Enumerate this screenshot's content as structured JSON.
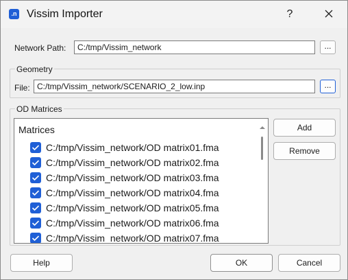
{
  "window": {
    "title": "Vissim Importer",
    "icon_label": ".n",
    "help_glyph": "?"
  },
  "network": {
    "label": "Network Path:",
    "value": "C:/tmp/Vissim_network",
    "browse_label": "..."
  },
  "geometry": {
    "group_title": "Geometry",
    "file_label": "File:",
    "value": "C:/tmp/Vissim_network/SCENARIO_2_low.inp",
    "browse_label": "..."
  },
  "od": {
    "group_title": "OD Matrices",
    "list_header": "Matrices",
    "items": [
      {
        "label": "C:/tmp/Vissim_network/OD matrix01.fma",
        "checked": true
      },
      {
        "label": "C:/tmp/Vissim_network/OD matrix02.fma",
        "checked": true
      },
      {
        "label": "C:/tmp/Vissim_network/OD matrix03.fma",
        "checked": true
      },
      {
        "label": "C:/tmp/Vissim_network/OD matrix04.fma",
        "checked": true
      },
      {
        "label": "C:/tmp/Vissim_network/OD matrix05.fma",
        "checked": true
      },
      {
        "label": "C:/tmp/Vissim_network/OD matrix06.fma",
        "checked": true
      },
      {
        "label": "C:/tmp/Vissim_network/OD matrix07.fma",
        "checked": true
      }
    ],
    "add_label": "Add",
    "remove_label": "Remove"
  },
  "footer": {
    "help_label": "Help",
    "ok_label": "OK",
    "cancel_label": "Cancel"
  },
  "colors": {
    "accent": "#1f5fd6"
  }
}
